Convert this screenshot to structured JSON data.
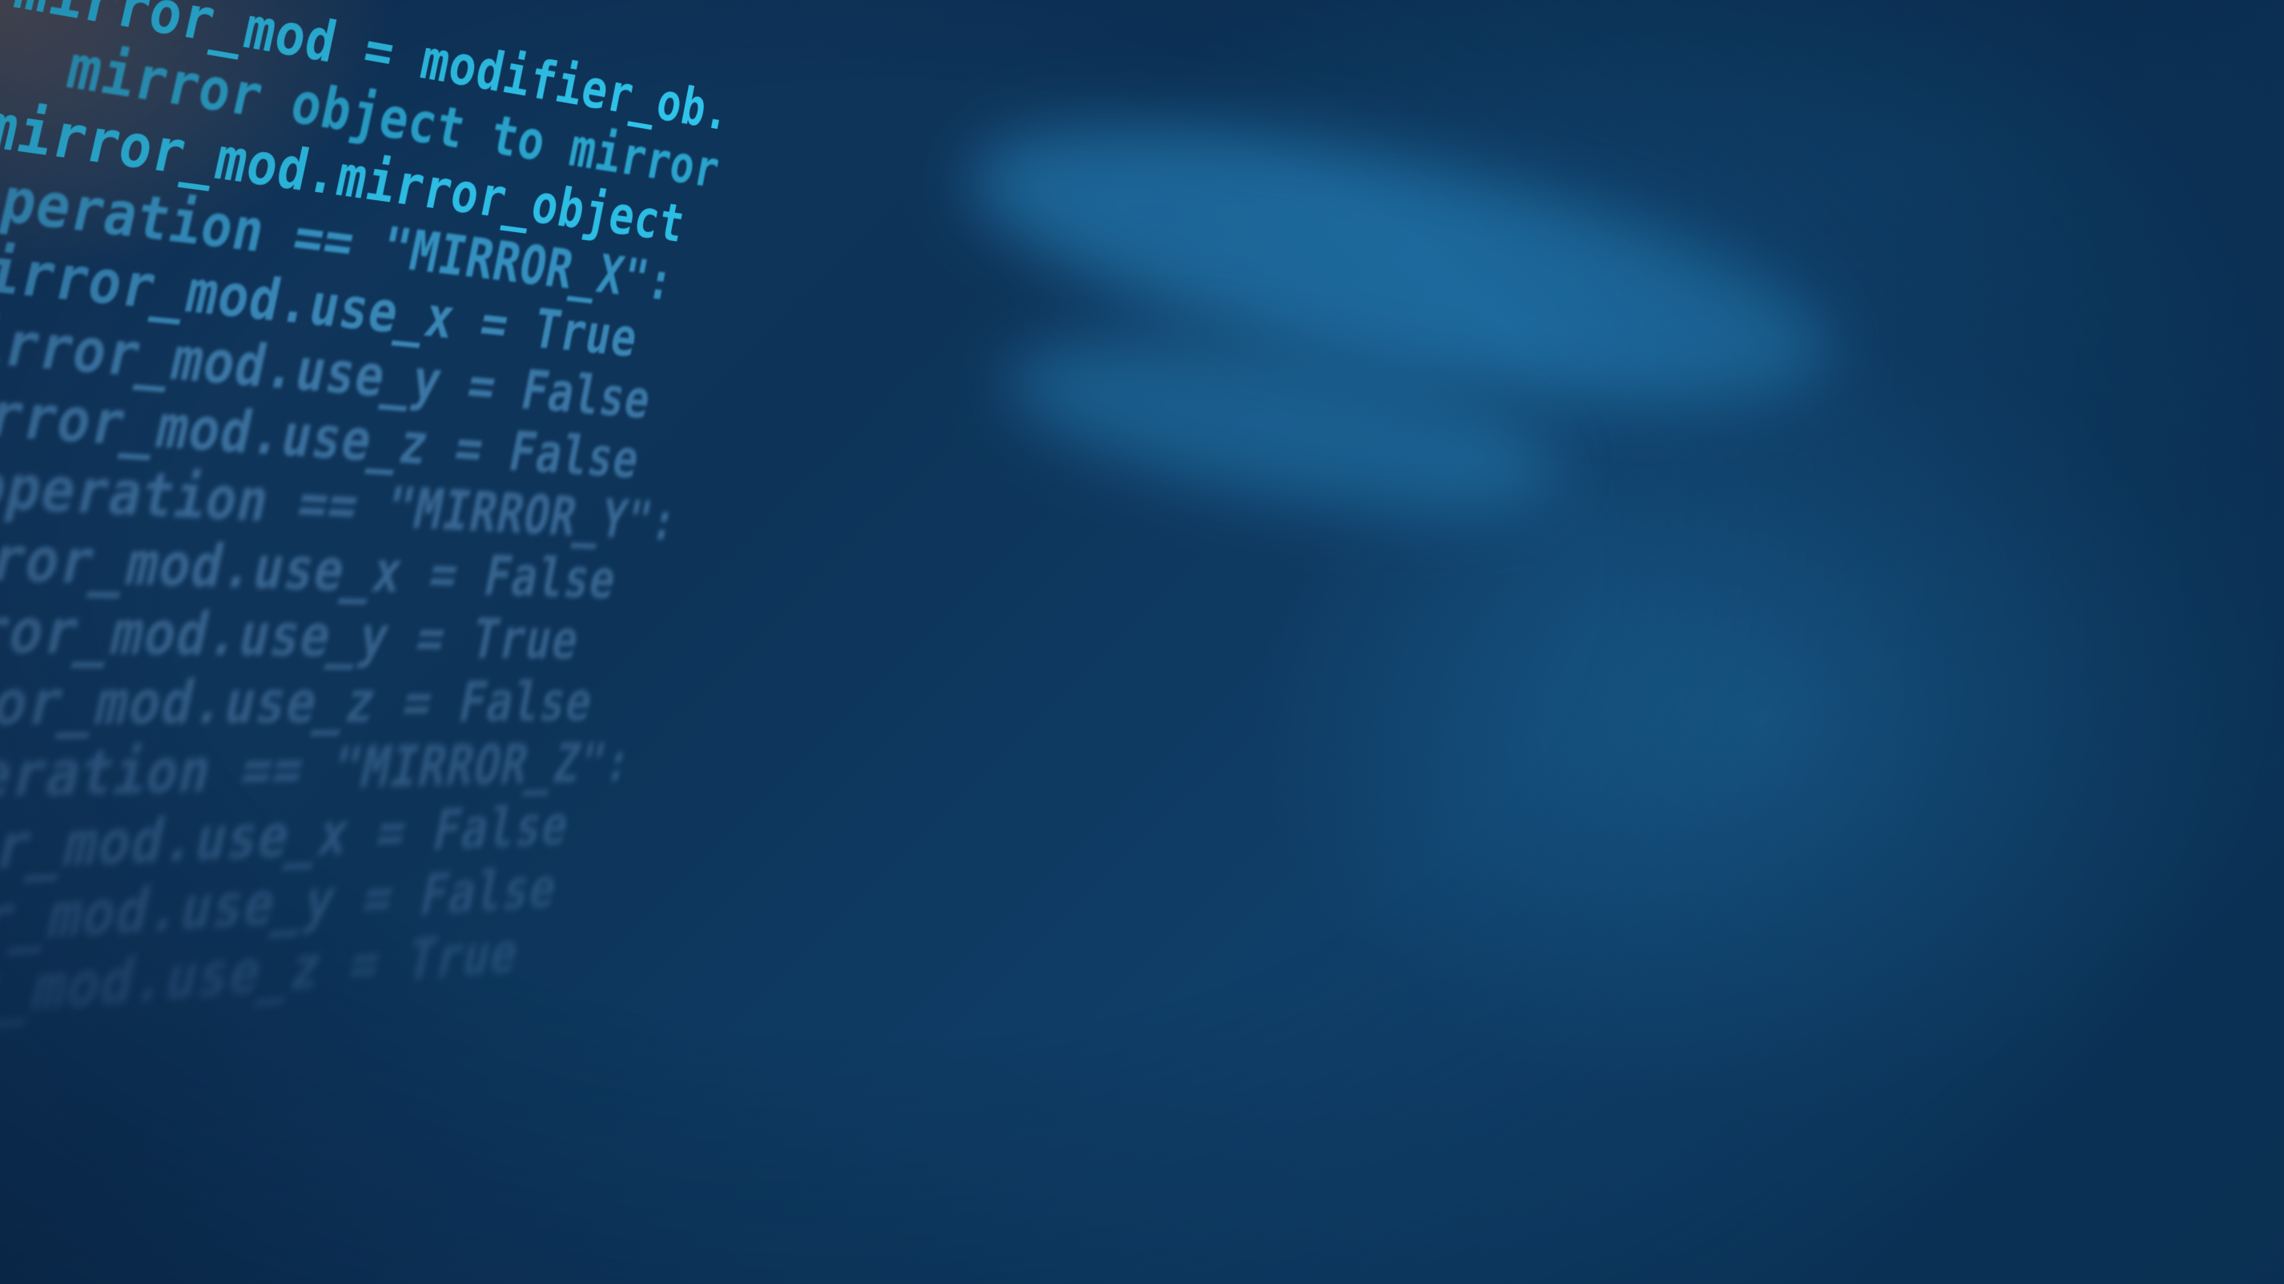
{
  "code_lines": [
    "mirror_mod = modifier_ob.",
    "  mirror object to mirror",
    "mirror_mod.mirror_object",
    "operation == \"MIRROR_X\":",
    "mirror_mod.use_x = True",
    "mirror_mod.use_y = False",
    "mirror_mod.use_z = False",
    " _operation == \"MIRROR_Y\":",
    "mirror_mod.use_x = False",
    "mirror_mod.use_y = True",
    "mirror_mod.use_z = False",
    " _operation == \"MIRROR_Z\":",
    "mirror_mod.use_x = False",
    "mirror_mod.use_y = False",
    "mirror_mod.use_z = True"
  ],
  "colors": {
    "background_dark": "#0b2a4e",
    "background_light": "#114a78",
    "code_text": "#2fc3ea"
  }
}
